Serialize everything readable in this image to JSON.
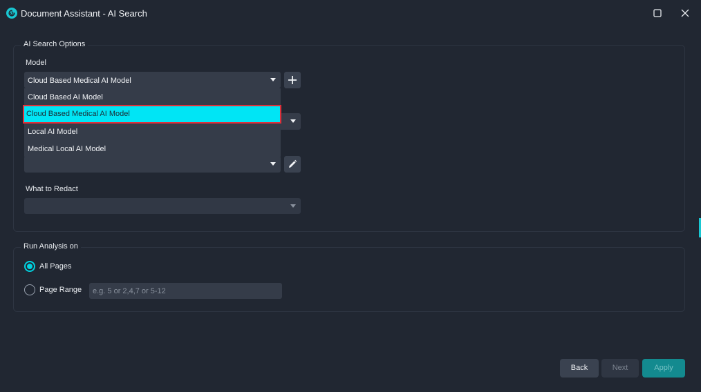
{
  "window": {
    "title": "Document Assistant - AI Search"
  },
  "ai_search_options": {
    "legend": "AI Search Options",
    "model": {
      "label": "Model",
      "selected": "Cloud Based Medical AI Model",
      "options": [
        "Cloud Based AI Model",
        "Cloud Based Medical AI Model",
        "Local AI Model",
        "Medical Local AI Model"
      ],
      "highlighted_index": 1
    },
    "what_to_redact": {
      "label": "What to Redact",
      "selected": ""
    }
  },
  "run_analysis": {
    "legend": "Run Analysis on",
    "all_pages_label": "All Pages",
    "page_range_label": "Page Range",
    "page_range_placeholder": "e.g. 5 or 2,4,7 or 5-12",
    "page_range_value": ""
  },
  "footer": {
    "back_label": "Back",
    "next_label": "Next",
    "apply_label": "Apply"
  },
  "colors": {
    "background": "#212732",
    "accent": "#00e5f5",
    "highlight_border": "#e0303a",
    "apply_button": "#138a8f"
  },
  "icons": {
    "app": "swirl-logo-icon",
    "maximize": "maximize-icon",
    "close": "close-icon",
    "add": "plus-icon",
    "edit": "pencil-icon",
    "dropdown": "caret-down-icon"
  }
}
